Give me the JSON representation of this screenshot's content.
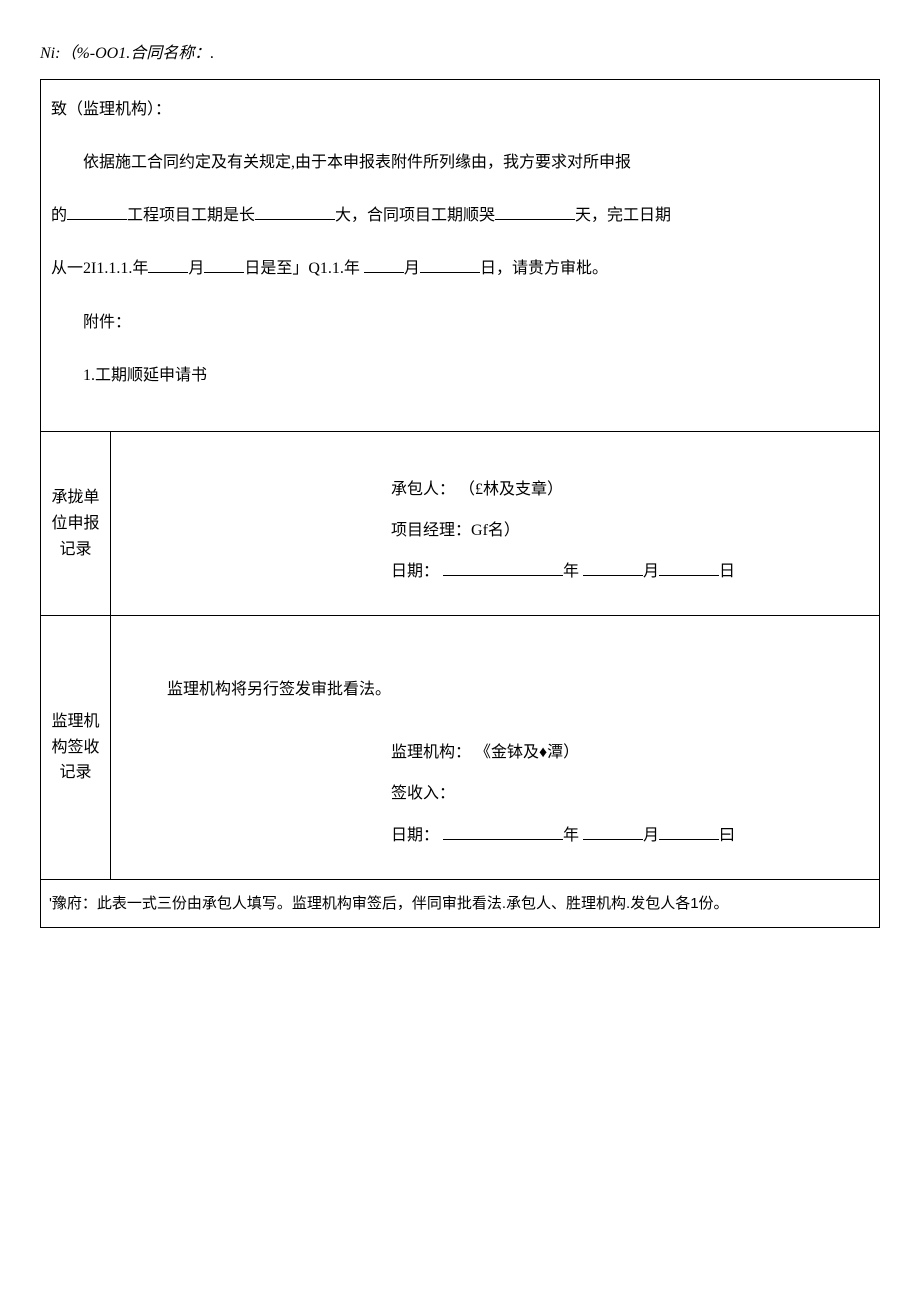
{
  "header": {
    "prefix": "Ni:（%-OO1.",
    "contract_label": "合同名称：.",
    "full": "Ni:（%-OO1.合同名称：."
  },
  "main": {
    "to_label": "致（监理机构）：",
    "body_line1_prefix": "依据施工合同约定及有关规定,由于本申报表附件所列缘由，我方要求对所申报",
    "body_line2_a": "的",
    "body_line2_b": "工程项目工期是长",
    "body_line2_c": "大，合同项目工期顺哭",
    "body_line2_d": "天，完工日期",
    "body_line3_a": "从一2I1.1.1.年",
    "body_line3_b": "月",
    "body_line3_c": "日是至」Q1.1.年",
    "body_line3_d": "月",
    "body_line3_e": "日，请贵方审枇。",
    "attach_label": "附件：",
    "attach_item1": "1.工期顺延申请书"
  },
  "row1": {
    "side": "承拢单位申报记录",
    "contractor_label": "承包人：",
    "contractor_note": "（£林及支章）",
    "pm_label": "项目经理：",
    "pm_note": "Gf名）",
    "date_label": "日期：",
    "year": "年",
    "month": "月",
    "day": "日"
  },
  "row2": {
    "side": "监理机构签收记录",
    "body": "监理机构将另行签发审批看法。",
    "org_label": "监理机构：",
    "org_note": "《金钵及♦潭）",
    "receiver_label": "签收入：",
    "date_label": "日期：",
    "year": "年",
    "month": "月",
    "day": "曰"
  },
  "footer": {
    "text": "'豫府：此表一式三份由承包人填写。监理机构审签后，伴同审批看法.承包人、胜理机构.发包人各1份。"
  }
}
